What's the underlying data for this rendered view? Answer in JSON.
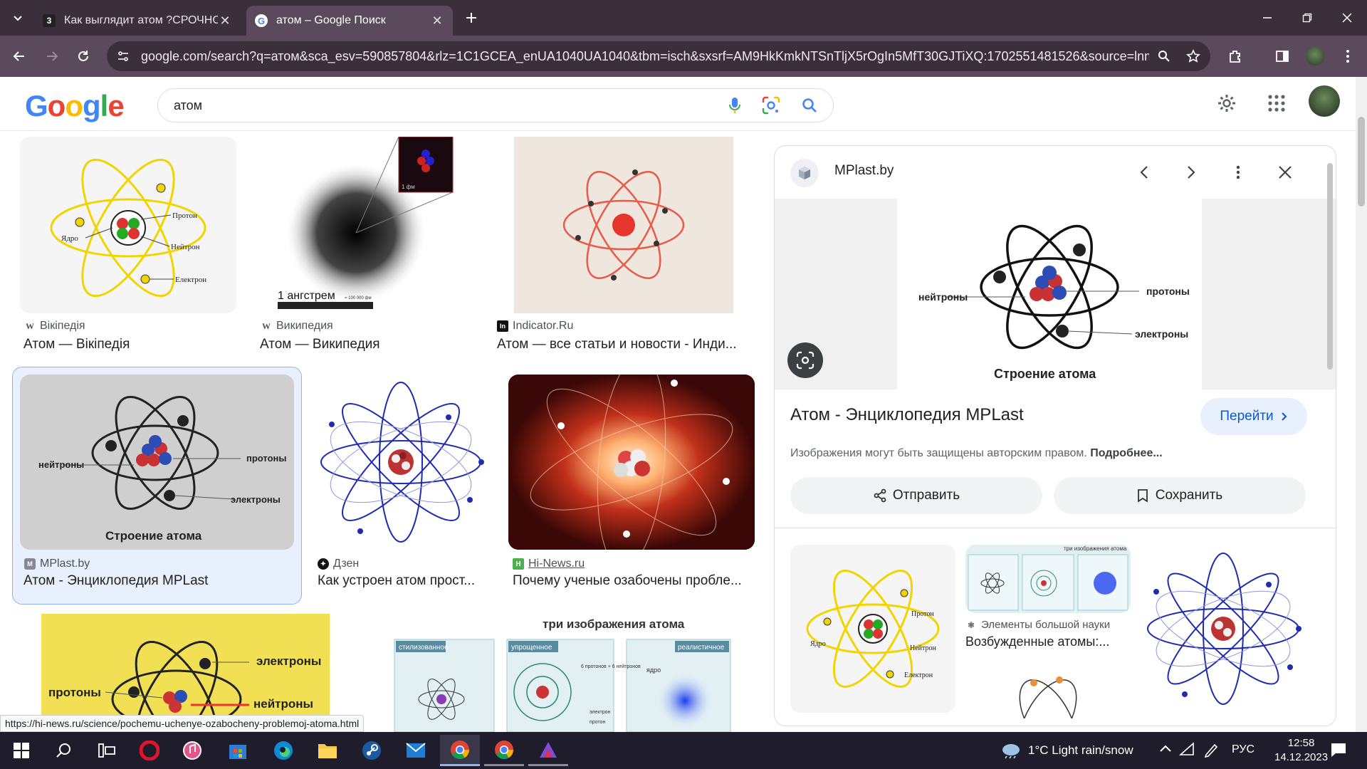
{
  "browser": {
    "tabs": [
      {
        "title": "Как выглядит атом ?СРОЧНОС",
        "favicon": "3"
      },
      {
        "title": "атом – Google Поиск",
        "favicon": "G"
      }
    ],
    "url": "google.com/search?q=атом&sca_esv=590857804&rlz=1C1GCEA_enUA1040UA1040&tbm=isch&sxsrf=AM9HkKmkNTSnTljX5rOgIn5MfT30GJTiXQ:1702551481526&source=lnms&sa..."
  },
  "google": {
    "logo": "Google",
    "query": "атом"
  },
  "results": [
    {
      "source": "Вікіпедія",
      "favicon": "W",
      "title": "Атом — Вікіпедія"
    },
    {
      "source": "Википедия",
      "favicon": "W",
      "title": "Атом — Википедия",
      "caption": "1 ангстрем",
      "caption_small": "= 100 000 фм",
      "inset_label": "1 фм"
    },
    {
      "source": "Indicator.Ru",
      "favicon": "In",
      "title": "Атом — все статьи и новости - Инди..."
    },
    {
      "source": "MPlast.by",
      "favicon": "M",
      "title": "Атом - Энциклопедия MPLast"
    },
    {
      "source": "Дзен",
      "favicon": "✦",
      "title": "Как устроен атом прост..."
    },
    {
      "source": "Hi-News.ru",
      "favicon": "H",
      "title": "Почему ученые озабочены пробле..."
    }
  ],
  "atom_labels": {
    "uk": {
      "proton": "Протон",
      "nucleus": "Ядро",
      "neutron": "Нейтрон",
      "electron": "Електрон"
    },
    "ru": {
      "neutrons": "нейтроны",
      "protons": "протоны",
      "electrons": "электроны",
      "caption": "Строение атома"
    }
  },
  "partial_row": {
    "third_title": "три изображения атома",
    "cells": [
      "стилизованное",
      "упрощенное",
      "реалистичное"
    ],
    "small1": "6 протонов + 6 нейтронов",
    "small2": "электрон",
    "small3": "протон",
    "small4": "ядро"
  },
  "panel": {
    "site": "MPlast.by",
    "title": "Атом - Энциклопедия MPLast",
    "visit_label": "Перейти",
    "copyright_note": "Изображения могут быть защищены авторским правом.",
    "more_link": "Подробнее...",
    "share_label": "Отправить",
    "save_label": "Сохранить",
    "related": {
      "source": "Элементы большой науки",
      "title": "Возбужденные атомы:..."
    }
  },
  "status_url": "https://hi-news.ru/science/pochemu-uchenye-ozabocheny-problemoj-atoma.html",
  "taskbar": {
    "weather": "1°C  Light rain/snow",
    "lang": "РУС",
    "time": "12:58",
    "date": "14.12.2023"
  },
  "colors": {
    "tabstrip": "#3b2f3c",
    "toolbar": "#5b4a5c",
    "taskbar": "#1f1d2b",
    "selected_card": "#e8f0fe"
  }
}
